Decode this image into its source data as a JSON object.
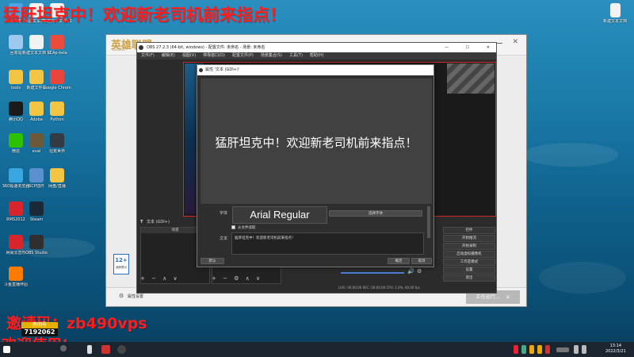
{
  "overlay": {
    "top_banner": "猛肝坦克中！欢迎新老司机前来指点！",
    "code_line": "邀请码：zb490vps",
    "bottom_line": "欢迎使用!",
    "room_label": "房间号",
    "room_number": "7192062"
  },
  "desktop_icons": [
    {
      "label": "此电脑",
      "color": "#4ea3e6"
    },
    {
      "label": "新建文本文档",
      "color": "#f2f2f2"
    },
    {
      "label": "新建文本文档 (1)",
      "color": "#f2f2f2"
    },
    {
      "label": "回收站",
      "color": "#9ec9ee"
    },
    {
      "label": "新建文本文档 (2)",
      "color": "#f2f2f2"
    },
    {
      "label": "SCAp-kela",
      "color": "#e94b3c"
    },
    {
      "label": "tools",
      "color": "#f4c542"
    },
    {
      "label": "新建文件夹",
      "color": "#f4c542"
    },
    {
      "label": "Google Chrome",
      "color": "#e8453c"
    },
    {
      "label": "腾讯QQ",
      "color": "#1a1a1a"
    },
    {
      "label": "Adobe",
      "color": "#f4c542"
    },
    {
      "label": "Python",
      "color": "#f4c542"
    },
    {
      "label": "微信",
      "color": "#2dc100"
    },
    {
      "label": "eval",
      "color": "#6b5a3a"
    },
    {
      "label": "坦克世界",
      "color": "#333a44"
    },
    {
      "label": "360极速浏览器",
      "color": "#3aa6e0"
    },
    {
      "label": "SCP插件",
      "color": "#5a8fd0"
    },
    {
      "label": "网盘/直播",
      "color": "#f4c542"
    },
    {
      "label": "RMS2012",
      "color": "#d6262b"
    },
    {
      "label": "Steam",
      "color": "#1b2838"
    },
    {
      "label": "网易云音乐",
      "color": "#d6262b"
    },
    {
      "label": "OBS Studio",
      "color": "#302e31"
    },
    {
      "label": "斗鱼直播伴侣",
      "color": "#ff7a00"
    }
  ],
  "right_icon": {
    "label": "新建文本文档",
    "color": "#f2f2f2"
  },
  "obs": {
    "title": "OBS 27.2.3 (64-bit, windows) - 配置文件: 未命名 - 场景: 未命名",
    "menu": [
      "文件(F)",
      "编辑(E)",
      "视图(V)",
      "停靠窗口(D)",
      "配置文件(P)",
      "场景集合(S)",
      "工具(T)",
      "帮助(H)"
    ],
    "source_label": "文本 (GDI+)",
    "scenes_header": "场景",
    "sources_header": "来源",
    "controls": [
      "控件",
      "开始推流",
      "开始录制",
      "启动虚拟摄像机",
      "工作室模式",
      "设置",
      "退出"
    ],
    "status": "LIVE: 00:00:00   REC: 00:00:00   CPU: 1.0%, 60.00 fps"
  },
  "dialog": {
    "title": "属性 '文本 (GDI+)'",
    "preview_text": "猛肝坦克中！欢迎新老司机前来指点！",
    "font_label": "字体",
    "font_value": "Arial Regular",
    "select_font": "选择字体",
    "from_file": "从文件读取",
    "text_label": "文本",
    "text_value": "猛肝坦克中！欢迎新老司机前来指点！",
    "defaults": "默认",
    "ok": "确定",
    "cancel": "取消"
  },
  "launcher": {
    "logo": "英雄联盟",
    "logo_sub": "LEAGUE",
    "bottom_left": "属性设置",
    "bottom_btn": "正在运行..."
  },
  "badge": {
    "age": "12+",
    "sub": "适龄提示"
  },
  "taskbar": {
    "time": "13:14",
    "date": "2022/3/21"
  },
  "colors": {
    "accent_red": "#ff1e1e",
    "obs_dark": "#2b2b2b",
    "taskbar": "#1b2530"
  }
}
